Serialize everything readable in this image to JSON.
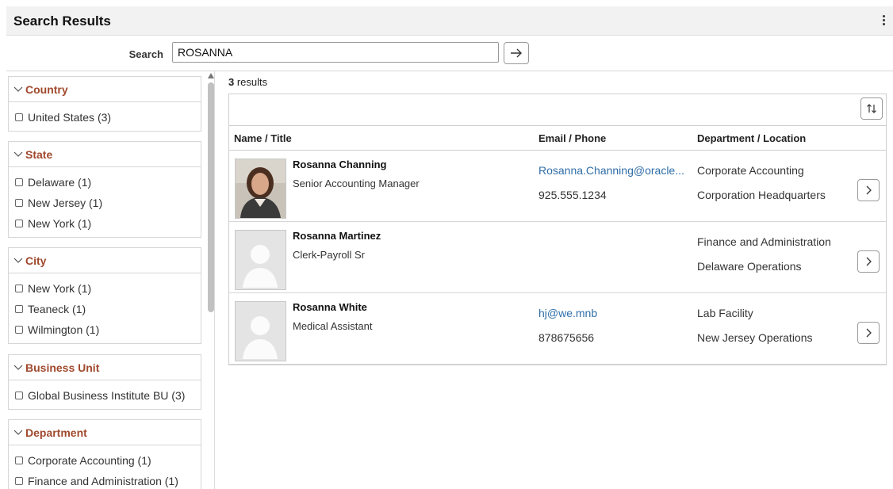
{
  "header": {
    "title": "Search Results"
  },
  "search": {
    "label": "Search",
    "value": "ROSANNA"
  },
  "facets": [
    {
      "title": "Country",
      "options": [
        "United States (3)"
      ]
    },
    {
      "title": "State",
      "options": [
        "Delaware (1)",
        "New Jersey (1)",
        "New York (1)"
      ]
    },
    {
      "title": "City",
      "options": [
        "New York (1)",
        "Teaneck (1)",
        "Wilmington (1)"
      ]
    },
    {
      "title": "Business Unit",
      "options": [
        "Global Business Institute BU (3)"
      ]
    },
    {
      "title": "Department",
      "options": [
        "Corporate Accounting (1)",
        "Finance and Administration (1)"
      ]
    }
  ],
  "results": {
    "count": "3",
    "count_label": " results",
    "columns": {
      "name": "Name / Title",
      "email": "Email / Phone",
      "dept": "Department / Location"
    },
    "rows": [
      {
        "name": "Rosanna Channing",
        "title": "Senior Accounting Manager",
        "email": "Rosanna.Channing@oracle...",
        "phone": "925.555.1234",
        "department": "Corporate Accounting",
        "location": "Corporation Headquarters"
      },
      {
        "name": "Rosanna Martinez",
        "title": "Clerk-Payroll Sr",
        "email": "",
        "phone": "",
        "department": "Finance and Administration",
        "location": "Delaware Operations"
      },
      {
        "name": "Rosanna White",
        "title": "Medical Assistant",
        "email": "hj@we.mnb",
        "phone": "878675656",
        "department": "Lab Facility",
        "location": "New Jersey Operations"
      }
    ]
  },
  "colors": {
    "facet_title": "#a0492d",
    "link": "#2f6ea8"
  },
  "icons": {
    "go": "arrow-right-icon",
    "sort": "sort-icon",
    "row_action": "chevron-right-icon",
    "menu": "kebab-menu-icon"
  }
}
